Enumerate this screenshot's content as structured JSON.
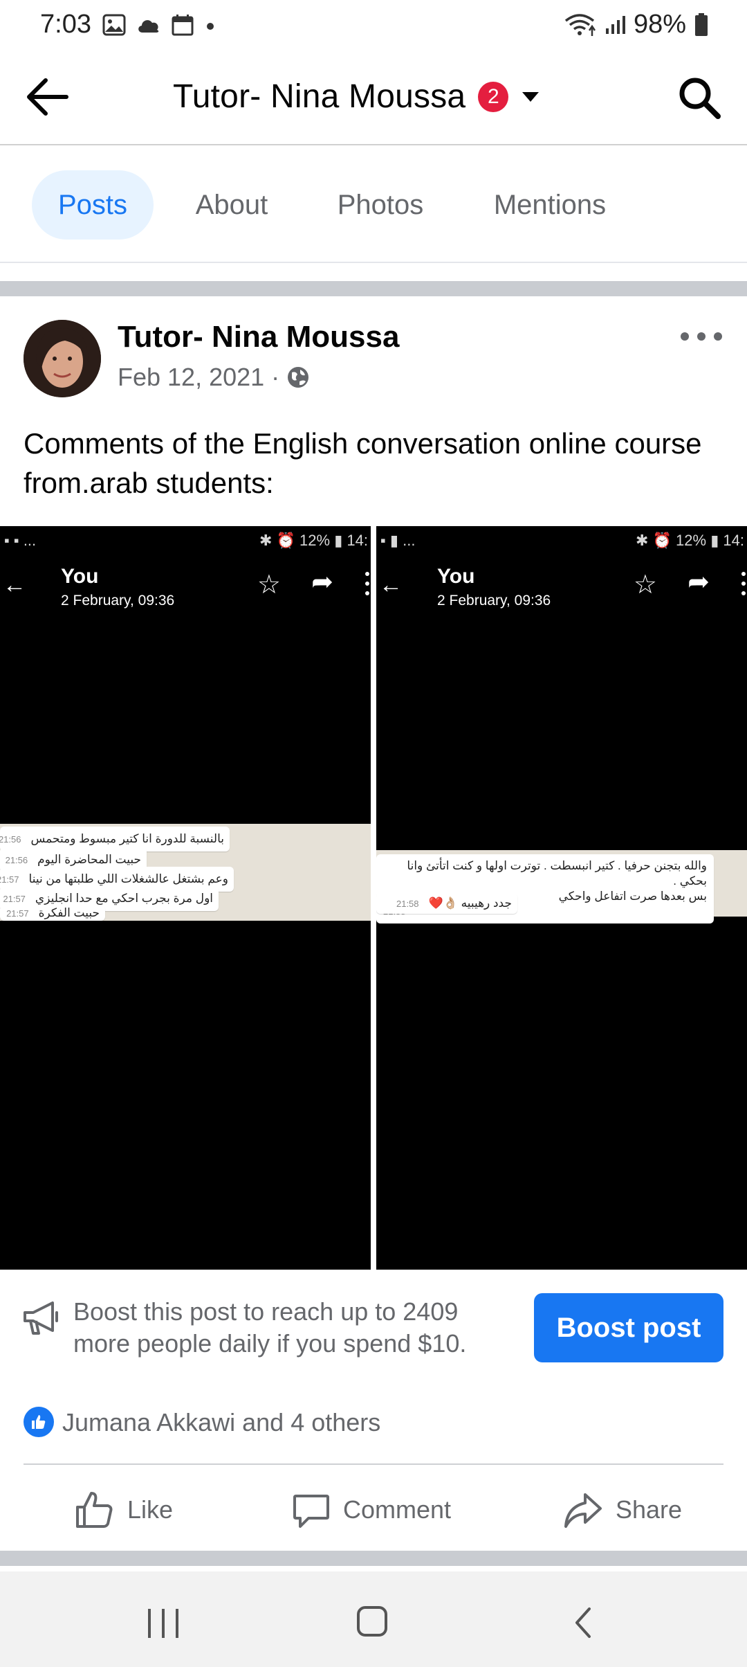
{
  "status_bar": {
    "time": "7:03",
    "battery": "98%"
  },
  "header": {
    "title": "Tutor- Nina Moussa",
    "badge_count": "2"
  },
  "tabs": [
    {
      "label": "Posts",
      "active": true
    },
    {
      "label": "About",
      "active": false
    },
    {
      "label": "Photos",
      "active": false
    },
    {
      "label": "Mentions",
      "active": false
    }
  ],
  "post": {
    "author": "Tutor- Nina Moussa",
    "date": "Feb 12, 2021 ·",
    "text": "Comments of the English conversation online course from.arab students:",
    "images": [
      {
        "status_left": "▪ ▪ ...",
        "status_right": "✱ ⏰ 12% ▮ 14:",
        "sender": "You",
        "timestamp": "2 February, 09:36",
        "messages": [
          {
            "text": "بالنسبة للدورة انا كتير مبسوط ومتحمس",
            "time": "21:56"
          },
          {
            "text": "حبيت المحاضرة اليوم",
            "time": "21:56"
          },
          {
            "text": "وعم بشتغل عالشغلات اللي طلبتها من نينا",
            "time": "21:57"
          },
          {
            "text": "اول مرة بجرب احكي مع حدا انجليزي",
            "time": "21:57"
          },
          {
            "text": "حبيت الفكرة",
            "time": "21:57"
          }
        ]
      },
      {
        "status_left": "▪ ▮ ...",
        "status_right": "✱ ⏰ 12% ▮ 14:",
        "sender": "You",
        "timestamp": "2 February, 09:36",
        "messages": [
          {
            "text": "والله بتجنن حرفيا . كتير انبسطت . توترت اولها و كنت اتأتئ وانا بحكي .",
            "text2": "بس بعدها صرت اتفاعل واحكي",
            "time": "21:58"
          },
          {
            "text": "جدد رهيبيه 👌🏼❤️",
            "time": "21:58"
          }
        ]
      }
    ]
  },
  "boost": {
    "text": "Boost this post to reach up to 2409 more people daily if you spend $10.",
    "button": "Boost post"
  },
  "reactions": {
    "text": "Jumana Akkawi and 4 others"
  },
  "actions": {
    "like": "Like",
    "comment": "Comment",
    "share": "Share"
  }
}
